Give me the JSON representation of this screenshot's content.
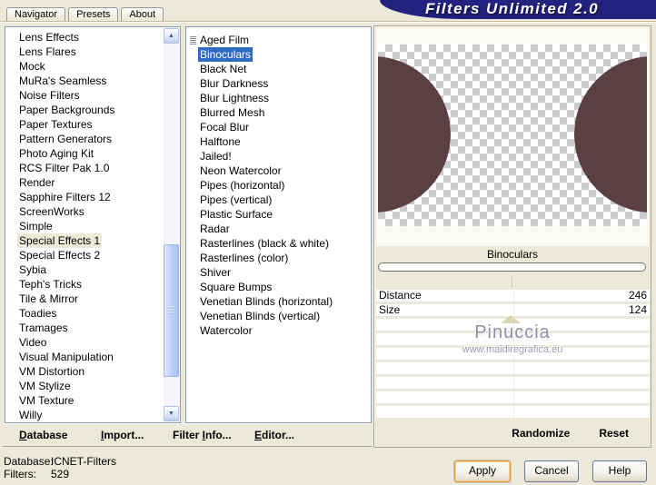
{
  "banner": {
    "title": "Filters Unlimited 2.0"
  },
  "tabs": [
    {
      "label": "Navigator",
      "selected": true
    },
    {
      "label": "Presets"
    },
    {
      "label": "About"
    }
  ],
  "categories": [
    {
      "label": "Lens Effects"
    },
    {
      "label": "Lens Flares"
    },
    {
      "label": "Mock"
    },
    {
      "label": "MuRa's Seamless"
    },
    {
      "label": "Noise Filters"
    },
    {
      "label": "Paper Backgrounds"
    },
    {
      "label": "Paper Textures"
    },
    {
      "label": "Pattern Generators"
    },
    {
      "label": "Photo Aging Kit"
    },
    {
      "label": "RCS Filter Pak 1.0"
    },
    {
      "label": "Render"
    },
    {
      "label": "Sapphire Filters 12"
    },
    {
      "label": "ScreenWorks"
    },
    {
      "label": "Simple"
    },
    {
      "label": "Special Effects 1",
      "selected": true
    },
    {
      "label": "Special Effects 2"
    },
    {
      "label": "Sybia"
    },
    {
      "label": "Teph's Tricks"
    },
    {
      "label": "Tile & Mirror"
    },
    {
      "label": "Toadies"
    },
    {
      "label": "Tramages"
    },
    {
      "label": "Video"
    },
    {
      "label": "Visual Manipulation"
    },
    {
      "label": "VM Distortion"
    },
    {
      "label": "VM Stylize"
    },
    {
      "label": "VM Texture"
    },
    {
      "label": "Willy"
    }
  ],
  "filters": [
    {
      "label": "Aged Film",
      "icon": true
    },
    {
      "label": "Binoculars",
      "selected": true
    },
    {
      "label": "Black Net"
    },
    {
      "label": "Blur Darkness"
    },
    {
      "label": "Blur Lightness"
    },
    {
      "label": "Blurred Mesh"
    },
    {
      "label": "Focal Blur"
    },
    {
      "label": "Halftone"
    },
    {
      "label": "Jailed!"
    },
    {
      "label": "Neon Watercolor"
    },
    {
      "label": "Pipes (horizontal)"
    },
    {
      "label": "Pipes (vertical)"
    },
    {
      "label": "Plastic Surface"
    },
    {
      "label": "Radar"
    },
    {
      "label": "Rasterlines (black & white)"
    },
    {
      "label": "Rasterlines (color)"
    },
    {
      "label": "Shiver"
    },
    {
      "label": "Square Bumps"
    },
    {
      "label": "Venetian Blinds (horizontal)"
    },
    {
      "label": "Venetian Blinds (vertical)"
    },
    {
      "label": "Watercolor"
    }
  ],
  "preview": {
    "caption": "Binoculars"
  },
  "sliders": [
    {
      "label": "Distance",
      "value": "246"
    },
    {
      "label": "Size",
      "value": "124"
    },
    {
      "label": "",
      "value": ""
    },
    {
      "label": "",
      "value": ""
    },
    {
      "label": "",
      "value": ""
    },
    {
      "label": "",
      "value": ""
    },
    {
      "label": "",
      "value": ""
    },
    {
      "label": "",
      "value": ""
    },
    {
      "label": "",
      "value": ""
    }
  ],
  "watermark": {
    "name": "Pinuccia",
    "site": "www.maidiregrafica.eu"
  },
  "tool_buttons": [
    {
      "pre": "",
      "mn": "D",
      "post": "atabase"
    },
    {
      "pre": "",
      "mn": "I",
      "post": "mport..."
    },
    {
      "pre": "Filter ",
      "mn": "I",
      "post": "nfo..."
    },
    {
      "pre": "",
      "mn": "E",
      "post": "ditor..."
    }
  ],
  "panel_buttons": {
    "randomize": "Randomize",
    "reset": "Reset"
  },
  "scrollbar": {
    "up": "▲",
    "down": "▼"
  },
  "status": {
    "db_label": "Database:",
    "db_value": "ICNET-Filters",
    "count_label": "Filters:",
    "count_value": "529"
  },
  "dialog_buttons": {
    "apply": "Apply",
    "cancel": "Cancel",
    "help": "Help"
  },
  "colors": {
    "banner_blue": "#23227f",
    "selection_blue": "#316ac5",
    "tab_accent_orange": "#ef9732",
    "dialog_beige": "#ece9d8",
    "apply_focus_ring": "#dd9a36"
  }
}
